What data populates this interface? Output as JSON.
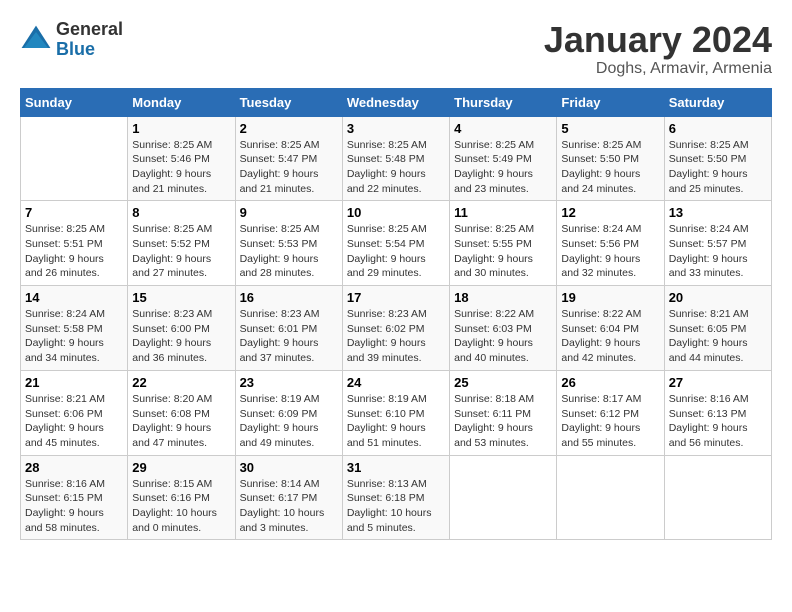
{
  "logo": {
    "general": "General",
    "blue": "Blue"
  },
  "title": "January 2024",
  "subtitle": "Doghs, Armavir, Armenia",
  "days_header": [
    "Sunday",
    "Monday",
    "Tuesday",
    "Wednesday",
    "Thursday",
    "Friday",
    "Saturday"
  ],
  "weeks": [
    [
      {
        "day": "",
        "sunrise": "",
        "sunset": "",
        "daylight": ""
      },
      {
        "day": "1",
        "sunrise": "Sunrise: 8:25 AM",
        "sunset": "Sunset: 5:46 PM",
        "daylight": "Daylight: 9 hours and 21 minutes."
      },
      {
        "day": "2",
        "sunrise": "Sunrise: 8:25 AM",
        "sunset": "Sunset: 5:47 PM",
        "daylight": "Daylight: 9 hours and 21 minutes."
      },
      {
        "day": "3",
        "sunrise": "Sunrise: 8:25 AM",
        "sunset": "Sunset: 5:48 PM",
        "daylight": "Daylight: 9 hours and 22 minutes."
      },
      {
        "day": "4",
        "sunrise": "Sunrise: 8:25 AM",
        "sunset": "Sunset: 5:49 PM",
        "daylight": "Daylight: 9 hours and 23 minutes."
      },
      {
        "day": "5",
        "sunrise": "Sunrise: 8:25 AM",
        "sunset": "Sunset: 5:50 PM",
        "daylight": "Daylight: 9 hours and 24 minutes."
      },
      {
        "day": "6",
        "sunrise": "Sunrise: 8:25 AM",
        "sunset": "Sunset: 5:50 PM",
        "daylight": "Daylight: 9 hours and 25 minutes."
      }
    ],
    [
      {
        "day": "7",
        "sunrise": "Sunrise: 8:25 AM",
        "sunset": "Sunset: 5:51 PM",
        "daylight": "Daylight: 9 hours and 26 minutes."
      },
      {
        "day": "8",
        "sunrise": "Sunrise: 8:25 AM",
        "sunset": "Sunset: 5:52 PM",
        "daylight": "Daylight: 9 hours and 27 minutes."
      },
      {
        "day": "9",
        "sunrise": "Sunrise: 8:25 AM",
        "sunset": "Sunset: 5:53 PM",
        "daylight": "Daylight: 9 hours and 28 minutes."
      },
      {
        "day": "10",
        "sunrise": "Sunrise: 8:25 AM",
        "sunset": "Sunset: 5:54 PM",
        "daylight": "Daylight: 9 hours and 29 minutes."
      },
      {
        "day": "11",
        "sunrise": "Sunrise: 8:25 AM",
        "sunset": "Sunset: 5:55 PM",
        "daylight": "Daylight: 9 hours and 30 minutes."
      },
      {
        "day": "12",
        "sunrise": "Sunrise: 8:24 AM",
        "sunset": "Sunset: 5:56 PM",
        "daylight": "Daylight: 9 hours and 32 minutes."
      },
      {
        "day": "13",
        "sunrise": "Sunrise: 8:24 AM",
        "sunset": "Sunset: 5:57 PM",
        "daylight": "Daylight: 9 hours and 33 minutes."
      }
    ],
    [
      {
        "day": "14",
        "sunrise": "Sunrise: 8:24 AM",
        "sunset": "Sunset: 5:58 PM",
        "daylight": "Daylight: 9 hours and 34 minutes."
      },
      {
        "day": "15",
        "sunrise": "Sunrise: 8:23 AM",
        "sunset": "Sunset: 6:00 PM",
        "daylight": "Daylight: 9 hours and 36 minutes."
      },
      {
        "day": "16",
        "sunrise": "Sunrise: 8:23 AM",
        "sunset": "Sunset: 6:01 PM",
        "daylight": "Daylight: 9 hours and 37 minutes."
      },
      {
        "day": "17",
        "sunrise": "Sunrise: 8:23 AM",
        "sunset": "Sunset: 6:02 PM",
        "daylight": "Daylight: 9 hours and 39 minutes."
      },
      {
        "day": "18",
        "sunrise": "Sunrise: 8:22 AM",
        "sunset": "Sunset: 6:03 PM",
        "daylight": "Daylight: 9 hours and 40 minutes."
      },
      {
        "day": "19",
        "sunrise": "Sunrise: 8:22 AM",
        "sunset": "Sunset: 6:04 PM",
        "daylight": "Daylight: 9 hours and 42 minutes."
      },
      {
        "day": "20",
        "sunrise": "Sunrise: 8:21 AM",
        "sunset": "Sunset: 6:05 PM",
        "daylight": "Daylight: 9 hours and 44 minutes."
      }
    ],
    [
      {
        "day": "21",
        "sunrise": "Sunrise: 8:21 AM",
        "sunset": "Sunset: 6:06 PM",
        "daylight": "Daylight: 9 hours and 45 minutes."
      },
      {
        "day": "22",
        "sunrise": "Sunrise: 8:20 AM",
        "sunset": "Sunset: 6:08 PM",
        "daylight": "Daylight: 9 hours and 47 minutes."
      },
      {
        "day": "23",
        "sunrise": "Sunrise: 8:19 AM",
        "sunset": "Sunset: 6:09 PM",
        "daylight": "Daylight: 9 hours and 49 minutes."
      },
      {
        "day": "24",
        "sunrise": "Sunrise: 8:19 AM",
        "sunset": "Sunset: 6:10 PM",
        "daylight": "Daylight: 9 hours and 51 minutes."
      },
      {
        "day": "25",
        "sunrise": "Sunrise: 8:18 AM",
        "sunset": "Sunset: 6:11 PM",
        "daylight": "Daylight: 9 hours and 53 minutes."
      },
      {
        "day": "26",
        "sunrise": "Sunrise: 8:17 AM",
        "sunset": "Sunset: 6:12 PM",
        "daylight": "Daylight: 9 hours and 55 minutes."
      },
      {
        "day": "27",
        "sunrise": "Sunrise: 8:16 AM",
        "sunset": "Sunset: 6:13 PM",
        "daylight": "Daylight: 9 hours and 56 minutes."
      }
    ],
    [
      {
        "day": "28",
        "sunrise": "Sunrise: 8:16 AM",
        "sunset": "Sunset: 6:15 PM",
        "daylight": "Daylight: 9 hours and 58 minutes."
      },
      {
        "day": "29",
        "sunrise": "Sunrise: 8:15 AM",
        "sunset": "Sunset: 6:16 PM",
        "daylight": "Daylight: 10 hours and 0 minutes."
      },
      {
        "day": "30",
        "sunrise": "Sunrise: 8:14 AM",
        "sunset": "Sunset: 6:17 PM",
        "daylight": "Daylight: 10 hours and 3 minutes."
      },
      {
        "day": "31",
        "sunrise": "Sunrise: 8:13 AM",
        "sunset": "Sunset: 6:18 PM",
        "daylight": "Daylight: 10 hours and 5 minutes."
      },
      {
        "day": "",
        "sunrise": "",
        "sunset": "",
        "daylight": ""
      },
      {
        "day": "",
        "sunrise": "",
        "sunset": "",
        "daylight": ""
      },
      {
        "day": "",
        "sunrise": "",
        "sunset": "",
        "daylight": ""
      }
    ]
  ]
}
